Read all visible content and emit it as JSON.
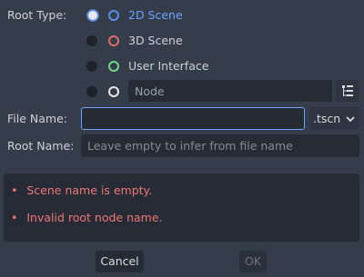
{
  "root_type": {
    "label": "Root Type:",
    "options": [
      {
        "label": "2D Scene",
        "ring_color": "#5b8ee6",
        "text_color": "#6ea3ff",
        "checked": true
      },
      {
        "label": "3D Scene",
        "ring_color": "#e36c6c",
        "text_color": "#cdd1d8",
        "checked": false
      },
      {
        "label": "User Interface",
        "ring_color": "#6fd88a",
        "text_color": "#cdd1d8",
        "checked": false
      },
      {
        "label": "Node",
        "ring_color": "#e8e8e8",
        "text_color": "#9aa0ab",
        "checked": false
      }
    ]
  },
  "file_name": {
    "label": "File Name:",
    "value": "",
    "extension": "▾"
  },
  "file_ext": ".tscn",
  "root_name": {
    "label": "Root Name:",
    "placeholder": "Leave empty to infer from file name"
  },
  "errors": [
    "Scene name is empty.",
    "Invalid root node name."
  ],
  "buttons": {
    "cancel": "Cancel",
    "ok": "OK"
  },
  "icons": {
    "node_picker": "tree-icon",
    "bullet": "•"
  }
}
